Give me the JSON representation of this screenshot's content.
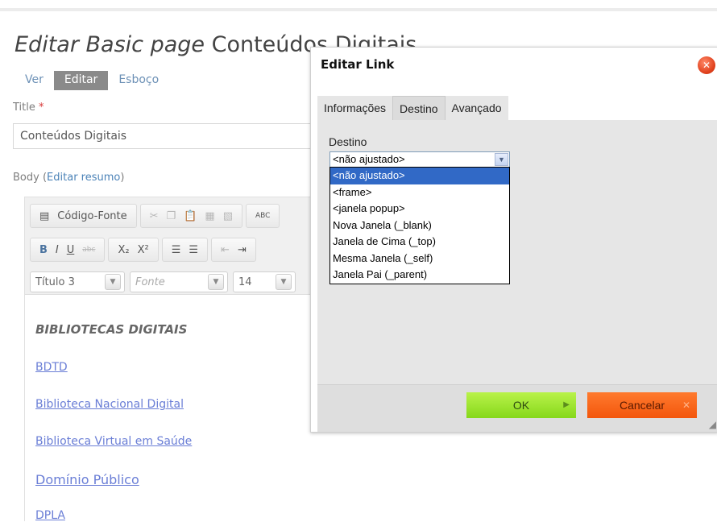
{
  "page": {
    "title_prefix": "Editar Basic page",
    "title_main": "Conteúdos Digitais",
    "tabs": [
      "Ver",
      "Editar",
      "Esboço"
    ],
    "title_label": "Title",
    "required_mark": "*",
    "title_value": "Conteúdos Digitais",
    "body_label": "Body",
    "edit_summary": "Editar resumo"
  },
  "editor": {
    "source_label": "Código-Fonte",
    "bold": "B",
    "italic": "I",
    "underline": "U",
    "strike": "abc",
    "subscript": "X₂",
    "superscript": "X²",
    "format_value": "Título 3",
    "font_placeholder": "Fonte",
    "size_value": "14",
    "spell_icon": "ABC"
  },
  "content": {
    "heading": "BIBLIOTECAS DIGITAIS",
    "links": [
      "BDTD",
      "Biblioteca Nacional Digital",
      "Biblioteca Virtual em Saúde",
      "Domínio Público",
      "DPLA"
    ]
  },
  "dialog": {
    "title": "Editar Link",
    "tabs": [
      "Informações",
      "Destino",
      "Avançado"
    ],
    "active_tab": "Destino",
    "field_label": "Destino",
    "selected": "<não ajustado>",
    "options": [
      "<não ajustado>",
      "<frame>",
      "<janela popup>",
      "Nova Janela (_blank)",
      "Janela de Cima (_top)",
      "Mesma Janela (_self)",
      "Janela Pai (_parent)"
    ],
    "ok_label": "OK",
    "cancel_label": "Cancelar"
  },
  "colors": {
    "ok_button": "#9ae330",
    "cancel_button": "#f5631a",
    "selected_option": "#3169c6",
    "link": "#6a7ed6"
  }
}
